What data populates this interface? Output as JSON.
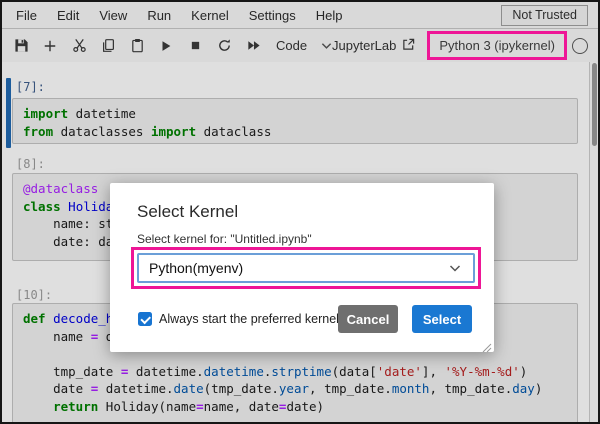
{
  "menubar": {
    "items": [
      "File",
      "Edit",
      "View",
      "Run",
      "Kernel",
      "Settings",
      "Help"
    ],
    "not_trusted_label": "Not Trusted"
  },
  "toolbar": {
    "icons": [
      "save-icon",
      "add-cell-icon",
      "cut-cell-icon",
      "copy-cell-icon",
      "paste-cell-icon",
      "run-icon",
      "interrupt-kernel-icon",
      "restart-kernel-icon",
      "restart-run-all-icon"
    ],
    "cell_type": "Code",
    "jupyterlab_link": "JupyterLab",
    "kernel_name": "Python 3 (ipykernel)"
  },
  "notebook": {
    "cells": [
      {
        "prompt": "[7]:",
        "active": true,
        "lines": [
          [
            {
              "t": "import",
              "s": "kw"
            },
            {
              "t": " datetime"
            }
          ],
          [
            {
              "t": "from",
              "s": "kw"
            },
            {
              "t": " dataclasses "
            },
            {
              "t": "import",
              "s": "kw"
            },
            {
              "t": " dataclass"
            }
          ]
        ]
      },
      {
        "prompt": "[8]:",
        "active": false,
        "lines": [
          [
            {
              "t": "@dataclass",
              "s": "meta"
            }
          ],
          [
            {
              "t": "class",
              "s": "kw"
            },
            {
              "t": " "
            },
            {
              "t": "Holida",
              "s": "def"
            }
          ],
          [
            {
              "t": "    name: st"
            }
          ],
          [
            {
              "t": "    date: da"
            }
          ]
        ]
      },
      {
        "prompt": "[10]:",
        "active": false,
        "lines": [
          [
            {
              "t": "def",
              "s": "kw"
            },
            {
              "t": " "
            },
            {
              "t": "decode_h",
              "s": "def"
            }
          ],
          [
            {
              "t": "    name "
            },
            {
              "t": "=",
              "s": "op"
            },
            {
              "t": " d"
            }
          ],
          [],
          [
            {
              "t": "    tmp_date "
            },
            {
              "t": "=",
              "s": "op"
            },
            {
              "t": " datetime."
            },
            {
              "t": "datetime",
              "s": "prop"
            },
            {
              "t": "."
            },
            {
              "t": "strptime",
              "s": "prop"
            },
            {
              "t": "(data["
            },
            {
              "t": "'date'",
              "s": "str"
            },
            {
              "t": "], "
            },
            {
              "t": "'%Y-%m-%d'",
              "s": "str"
            },
            {
              "t": ")"
            }
          ],
          [
            {
              "t": "    date "
            },
            {
              "t": "=",
              "s": "op"
            },
            {
              "t": " datetime."
            },
            {
              "t": "date",
              "s": "prop"
            },
            {
              "t": "(tmp_date."
            },
            {
              "t": "year",
              "s": "prop"
            },
            {
              "t": ", tmp_date."
            },
            {
              "t": "month",
              "s": "prop"
            },
            {
              "t": ", tmp_date."
            },
            {
              "t": "day",
              "s": "prop"
            },
            {
              "t": ")"
            }
          ],
          [
            {
              "t": "    "
            },
            {
              "t": "return",
              "s": "kw"
            },
            {
              "t": " Holiday(name"
            },
            {
              "t": "=",
              "s": "op"
            },
            {
              "t": "name, date"
            },
            {
              "t": "=",
              "s": "op"
            },
            {
              "t": "date)"
            }
          ]
        ]
      }
    ]
  },
  "dialog": {
    "title": "Select Kernel",
    "label": "Select kernel for: \"Untitled.ipynb\"",
    "dropdown_value": "Python(myenv)",
    "checkbox_label": "Always start the preferred kernel",
    "checkbox_checked": true,
    "cancel_label": "Cancel",
    "select_label": "Select"
  },
  "colors": {
    "annotation_pink": "#ee1696",
    "select_button_blue": "#1a78d2",
    "cancel_button_gray": "#6f6f6f",
    "checkbox_blue": "#1774d1",
    "active_cell_bar_blue": "#2068b0",
    "keyword_green": "#008000",
    "string_red": "#ba2121",
    "operator_purple": "#aa22ff",
    "property_blue": "#0055aa"
  }
}
